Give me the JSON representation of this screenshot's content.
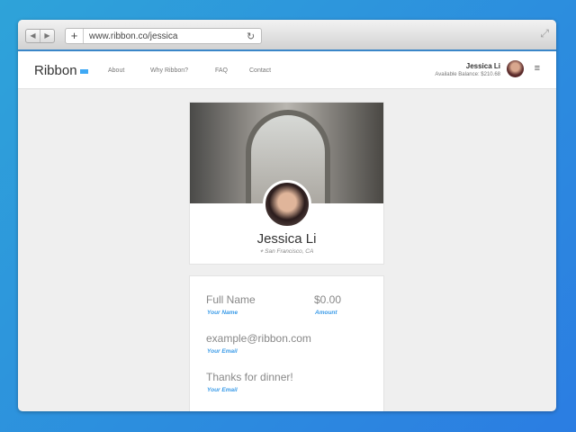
{
  "browser": {
    "url": "www.ribbon.co/jessica",
    "back": "◀",
    "forward": "▶",
    "new_tab": "+",
    "reload": "↻",
    "expand": "⤢"
  },
  "nav": {
    "logo": "Ribbon",
    "links": [
      "About",
      "Why Ribbon?",
      "FAQ",
      "Contact"
    ],
    "user_name": "Jessica Li",
    "balance": "Available Balance: $210.68",
    "menu": "≡"
  },
  "profile": {
    "name": "Jessica Li",
    "location": "San Francisco, CA"
  },
  "form": {
    "full_name": "Full Name",
    "full_name_label": "Your Name",
    "amount": "$0.00",
    "amount_label": "Amount",
    "email": "example@ribbon.com",
    "email_label": "Your Email",
    "message": "Thanks for dinner!",
    "message_label": "Your Email"
  }
}
